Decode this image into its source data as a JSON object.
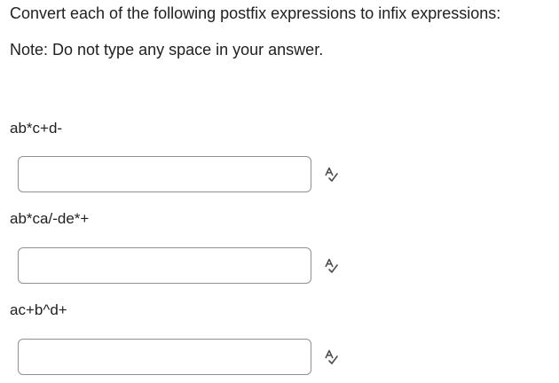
{
  "instructions": {
    "line1": "Convert each of the following postfix expressions to infix expressions:",
    "line2": "Note: Do not type any space in your answer."
  },
  "questions": [
    {
      "expression": "ab*c+d-",
      "answer_value": ""
    },
    {
      "expression": "ab*ca/-de*+",
      "answer_value": ""
    },
    {
      "expression": "ac+b^d+",
      "answer_value": ""
    }
  ],
  "icons": {
    "spell_check": "spell-check-icon"
  },
  "colors": {
    "text": "#202122",
    "input_border": "#8f9194",
    "icon": "#494c4e"
  }
}
